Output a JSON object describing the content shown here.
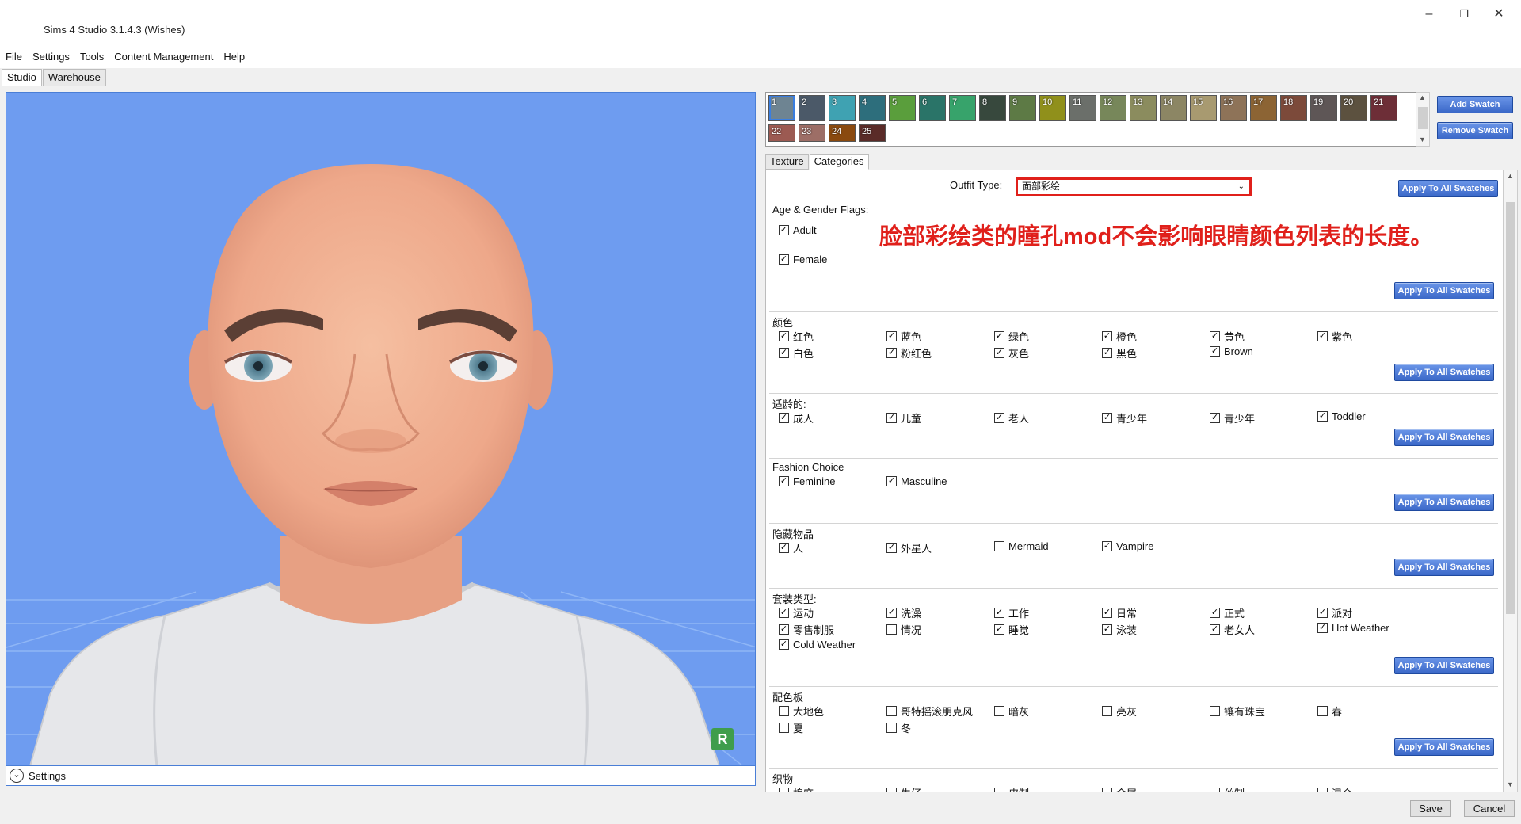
{
  "window": {
    "title": "Sims 4 Studio 3.1.4.3 (Wishes)"
  },
  "menu": [
    "File",
    "Settings",
    "Tools",
    "Content Management",
    "Help"
  ],
  "top_tabs": [
    "Studio",
    "Warehouse"
  ],
  "viewport": {
    "badge": "R",
    "settings_label": "Settings"
  },
  "swatches": {
    "items": [
      {
        "label": "1",
        "color": "#6e8492"
      },
      {
        "label": "2",
        "color": "#4b5968"
      },
      {
        "label": "3",
        "color": "#3fa2b2"
      },
      {
        "label": "4",
        "color": "#2d6e7c"
      },
      {
        "label": "5",
        "color": "#5a9e3c"
      },
      {
        "label": "6",
        "color": "#2a7468"
      },
      {
        "label": "7",
        "color": "#37a36b"
      },
      {
        "label": "8",
        "color": "#37483d"
      },
      {
        "label": "9",
        "color": "#5d7a45"
      },
      {
        "label": "10",
        "color": "#90901b"
      },
      {
        "label": "11",
        "color": "#6b6f6a"
      },
      {
        "label": "12",
        "color": "#77875a"
      },
      {
        "label": "13",
        "color": "#8b8c5e"
      },
      {
        "label": "14",
        "color": "#8c8664"
      },
      {
        "label": "15",
        "color": "#a89a70"
      },
      {
        "label": "16",
        "color": "#8e7358"
      },
      {
        "label": "17",
        "color": "#8c6434"
      },
      {
        "label": "18",
        "color": "#7c4a3a"
      },
      {
        "label": "19",
        "color": "#5e5656"
      },
      {
        "label": "20",
        "color": "#5c513f"
      },
      {
        "label": "21",
        "color": "#6d2e37"
      },
      {
        "label": "22",
        "color": "#9c5a52"
      },
      {
        "label": "23",
        "color": "#9d6e66"
      },
      {
        "label": "24",
        "color": "#8a4a0f"
      },
      {
        "label": "25",
        "color": "#5a2b28"
      }
    ],
    "add_label": "Add Swatch",
    "remove_label": "Remove Swatch"
  },
  "panel_tabs": [
    "Texture",
    "Categories"
  ],
  "outfit": {
    "label": "Outfit Type:",
    "value": "面部彩绘"
  },
  "apply_label": "Apply To All Swatches",
  "annotation": "脸部彩绘类的瞳孔mod不会影响眼睛颜色列表的长度。",
  "age_gender": {
    "title": "Age & Gender Flags:",
    "items": [
      {
        "label": "Adult",
        "checked": true
      },
      {
        "label": "Female",
        "checked": true
      }
    ]
  },
  "sections": [
    {
      "title": "颜色",
      "items": [
        {
          "label": "红色",
          "checked": true
        },
        {
          "label": "蓝色",
          "checked": true
        },
        {
          "label": "绿色",
          "checked": true
        },
        {
          "label": "橙色",
          "checked": true
        },
        {
          "label": "黄色",
          "checked": true
        },
        {
          "label": "紫色",
          "checked": true
        },
        {
          "label": "白色",
          "checked": true
        },
        {
          "label": "粉红色",
          "checked": true
        },
        {
          "label": "灰色",
          "checked": true
        },
        {
          "label": "黑色",
          "checked": true
        },
        {
          "label": "Brown",
          "checked": true
        }
      ]
    },
    {
      "title": "适龄的:",
      "items": [
        {
          "label": "成人",
          "checked": true
        },
        {
          "label": "儿童",
          "checked": true
        },
        {
          "label": "老人",
          "checked": true
        },
        {
          "label": "青少年",
          "checked": true
        },
        {
          "label": "青少年",
          "checked": true
        },
        {
          "label": "Toddler",
          "checked": true
        }
      ]
    },
    {
      "title": "Fashion Choice",
      "items": [
        {
          "label": "Feminine",
          "checked": true
        },
        {
          "label": "Masculine",
          "checked": true
        }
      ]
    },
    {
      "title": "隐藏物品",
      "items": [
        {
          "label": "人",
          "checked": true
        },
        {
          "label": "外星人",
          "checked": true
        },
        {
          "label": "Mermaid",
          "checked": false
        },
        {
          "label": "Vampire",
          "checked": true
        }
      ]
    },
    {
      "title": "套装类型:",
      "items": [
        {
          "label": "运动",
          "checked": true
        },
        {
          "label": "洗澡",
          "checked": true
        },
        {
          "label": "工作",
          "checked": true
        },
        {
          "label": "日常",
          "checked": true
        },
        {
          "label": "正式",
          "checked": true
        },
        {
          "label": "派对",
          "checked": true
        },
        {
          "label": "零售制服",
          "checked": true
        },
        {
          "label": "情况",
          "checked": false
        },
        {
          "label": "睡觉",
          "checked": true
        },
        {
          "label": "泳装",
          "checked": true
        },
        {
          "label": "老女人",
          "checked": true
        },
        {
          "label": "Hot Weather",
          "checked": true
        },
        {
          "label": "Cold Weather",
          "checked": true
        }
      ]
    },
    {
      "title": "配色板",
      "items": [
        {
          "label": "大地色",
          "checked": false
        },
        {
          "label": "哥特摇滚朋克风",
          "checked": false
        },
        {
          "label": "暗灰",
          "checked": false
        },
        {
          "label": "亮灰",
          "checked": false
        },
        {
          "label": "镶有珠宝",
          "checked": false
        },
        {
          "label": "春",
          "checked": false
        },
        {
          "label": "夏",
          "checked": false
        },
        {
          "label": "冬",
          "checked": false
        }
      ]
    },
    {
      "title": "织物",
      "items": [
        {
          "label": "棉麻",
          "checked": false
        },
        {
          "label": "牛仔",
          "checked": false
        },
        {
          "label": "皮制",
          "checked": false
        },
        {
          "label": "金属",
          "checked": false
        },
        {
          "label": "丝制",
          "checked": false
        },
        {
          "label": "混合",
          "checked": false
        }
      ]
    }
  ],
  "footer": {
    "save": "Save",
    "cancel": "Cancel"
  }
}
